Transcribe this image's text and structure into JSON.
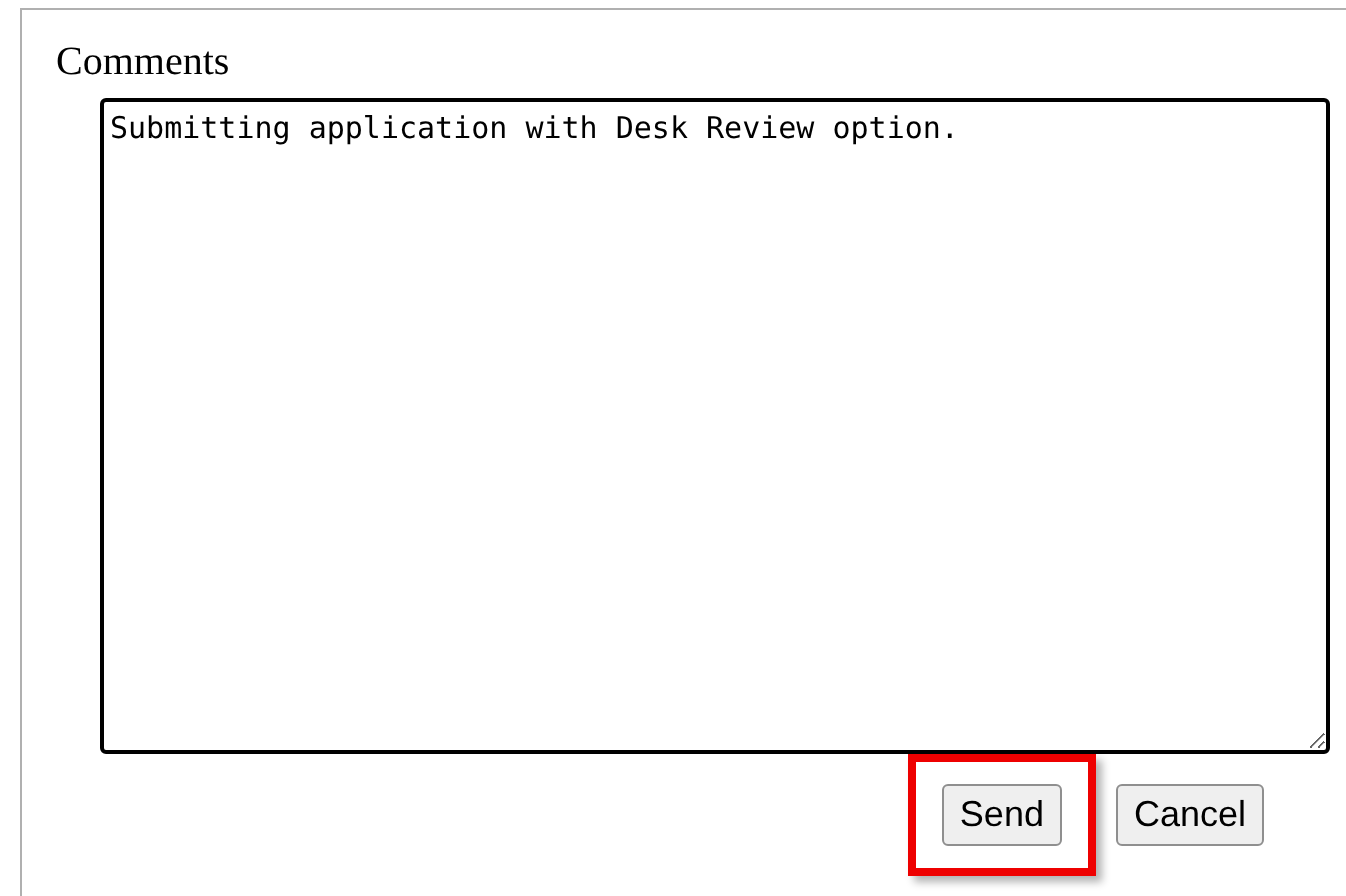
{
  "comments": {
    "label": "Comments",
    "value": "Submitting application with Desk Review option."
  },
  "buttons": [
    {
      "label": "Send",
      "highlighted": true
    },
    {
      "label": "Cancel",
      "highlighted": false
    }
  ]
}
